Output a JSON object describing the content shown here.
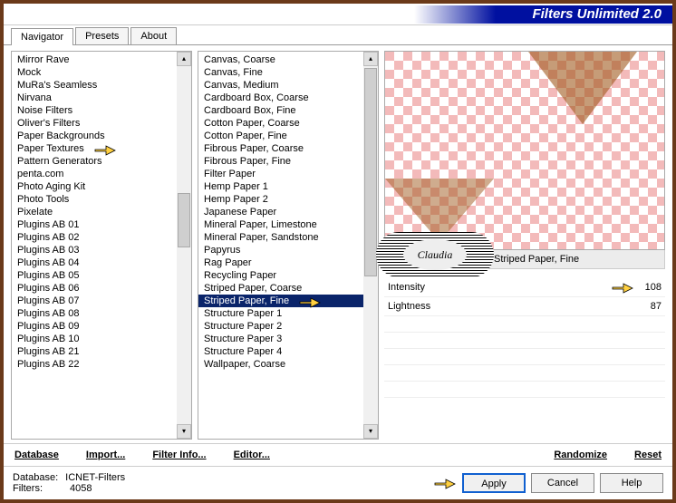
{
  "title": "Filters Unlimited 2.0",
  "tabs": [
    "Navigator",
    "Presets",
    "About"
  ],
  "active_tab": 0,
  "categories": [
    "Mirror Rave",
    "Mock",
    "MuRa's Seamless",
    "Nirvana",
    "Noise Filters",
    "Oliver's Filters",
    "Paper Backgrounds",
    "Paper Textures",
    "Pattern Generators",
    "penta.com",
    "Photo Aging Kit",
    "Photo Tools",
    "Pixelate",
    "Plugins AB 01",
    "Plugins AB 02",
    "Plugins AB 03",
    "Plugins AB 04",
    "Plugins AB 05",
    "Plugins AB 06",
    "Plugins AB 07",
    "Plugins AB 08",
    "Plugins AB 09",
    "Plugins AB 10",
    "Plugins AB 21",
    "Plugins AB 22"
  ],
  "highlighted_category": "Paper Textures",
  "filters": [
    "Canvas, Coarse",
    "Canvas, Fine",
    "Canvas, Medium",
    "Cardboard Box, Coarse",
    "Cardboard Box, Fine",
    "Cotton Paper, Coarse",
    "Cotton Paper, Fine",
    "Fibrous Paper, Coarse",
    "Fibrous Paper, Fine",
    "Filter Paper",
    "Hemp Paper 1",
    "Hemp Paper 2",
    "Japanese Paper",
    "Mineral Paper, Limestone",
    "Mineral Paper, Sandstone",
    "Papyrus",
    "Rag Paper",
    "Recycling Paper",
    "Striped Paper, Coarse",
    "Striped Paper, Fine",
    "Structure Paper 1",
    "Structure Paper 2",
    "Structure Paper 3",
    "Structure Paper 4",
    "Wallpaper, Coarse"
  ],
  "selected_filter": "Striped Paper, Fine",
  "current_filter_label": "Striped Paper, Fine",
  "sliders": [
    {
      "name": "Intensity",
      "value": 108,
      "pointer": true
    },
    {
      "name": "Lightness",
      "value": 87,
      "pointer": false
    }
  ],
  "links": {
    "database": "Database",
    "import": "Import...",
    "filterinfo": "Filter Info...",
    "editor": "Editor...",
    "randomize": "Randomize",
    "reset": "Reset"
  },
  "footer": {
    "db_label": "Database:",
    "db_value": "ICNET-Filters",
    "filters_label": "Filters:",
    "filters_value": "4058"
  },
  "buttons": {
    "apply": "Apply",
    "cancel": "Cancel",
    "help": "Help"
  },
  "watermark": "Claudia"
}
